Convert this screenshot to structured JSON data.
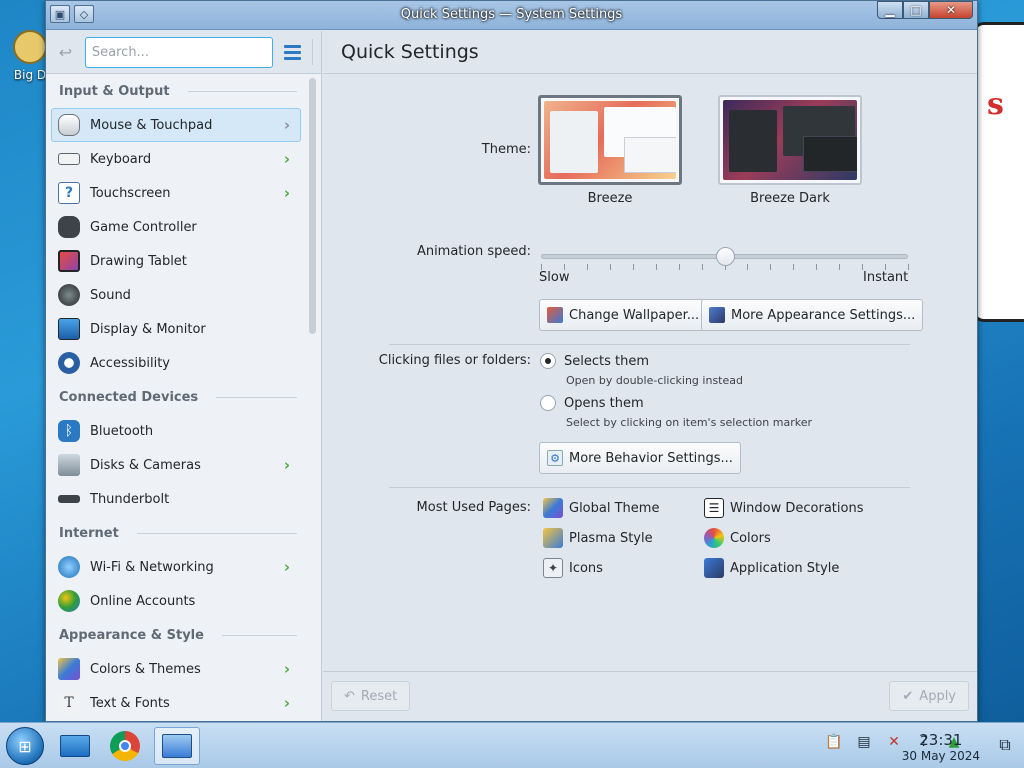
{
  "desktop": {
    "icon_label": "Big D"
  },
  "window": {
    "title": "Quick Settings — System Settings",
    "controls": {
      "minimize": "▁",
      "maximize": "□",
      "close": "✕"
    }
  },
  "sidebar": {
    "search_placeholder": "Search...",
    "sections": [
      {
        "title": "Input & Output",
        "items": [
          {
            "label": "Mouse & Touchpad",
            "icon": "mouse-icon",
            "has_children": true,
            "selected": true
          },
          {
            "label": "Keyboard",
            "icon": "keyboard-icon",
            "has_children": true
          },
          {
            "label": "Touchscreen",
            "icon": "touchscreen-icon",
            "has_children": true
          },
          {
            "label": "Game Controller",
            "icon": "gamepad-icon",
            "has_children": false
          },
          {
            "label": "Drawing Tablet",
            "icon": "tablet-icon",
            "has_children": false
          },
          {
            "label": "Sound",
            "icon": "speaker-icon",
            "has_children": false
          },
          {
            "label": "Display & Monitor",
            "icon": "monitor-icon",
            "has_children": false
          },
          {
            "label": "Accessibility",
            "icon": "accessibility-icon",
            "has_children": false
          }
        ]
      },
      {
        "title": "Connected Devices",
        "items": [
          {
            "label": "Bluetooth",
            "icon": "bluetooth-icon",
            "has_children": false
          },
          {
            "label": "Disks & Cameras",
            "icon": "disks-icon",
            "has_children": true
          },
          {
            "label": "Thunderbolt",
            "icon": "thunderbolt-icon",
            "has_children": false
          }
        ]
      },
      {
        "title": "Internet",
        "items": [
          {
            "label": "Wi-Fi & Networking",
            "icon": "network-icon",
            "has_children": true
          },
          {
            "label": "Online Accounts",
            "icon": "online-accounts-icon",
            "has_children": false
          }
        ]
      },
      {
        "title": "Appearance & Style",
        "items": [
          {
            "label": "Colors & Themes",
            "icon": "colors-themes-icon",
            "has_children": true
          },
          {
            "label": "Text & Fonts",
            "icon": "fonts-icon",
            "has_children": true
          }
        ]
      }
    ]
  },
  "main": {
    "title": "Quick Settings",
    "theme": {
      "label": "Theme:",
      "options": [
        {
          "name": "Breeze",
          "selected": true
        },
        {
          "name": "Breeze Dark",
          "selected": false
        }
      ]
    },
    "animation": {
      "label": "Animation speed:",
      "min_label": "Slow",
      "max_label": "Instant",
      "value_fraction": 0.5,
      "tick_count": 17
    },
    "appearance_buttons": {
      "change_wallpaper": "Change Wallpaper...",
      "more_appearance": "More Appearance Settings..."
    },
    "clicking": {
      "label": "Clicking files or folders:",
      "options": [
        {
          "label": "Selects them",
          "sub": "Open by double-clicking instead",
          "checked": true
        },
        {
          "label": "Opens them",
          "sub": "Select by clicking on item's selection marker",
          "checked": false
        }
      ],
      "more_behavior": "More Behavior Settings..."
    },
    "most_used": {
      "label": "Most Used Pages:",
      "pages": [
        {
          "label": "Global Theme",
          "icon": "global-theme-icon"
        },
        {
          "label": "Window Decorations",
          "icon": "window-decorations-icon"
        },
        {
          "label": "Plasma Style",
          "icon": "plasma-style-icon"
        },
        {
          "label": "Colors",
          "icon": "colors-icon"
        },
        {
          "label": "Icons",
          "icon": "icons-icon"
        },
        {
          "label": "Application Style",
          "icon": "application-style-icon"
        }
      ]
    },
    "footer": {
      "reset": "Reset",
      "apply": "Apply"
    }
  },
  "taskbar": {
    "time": "23:31",
    "date": "30 May 2024",
    "apps": [
      "file-manager-icon",
      "chrome-icon",
      "system-settings-icon"
    ]
  }
}
